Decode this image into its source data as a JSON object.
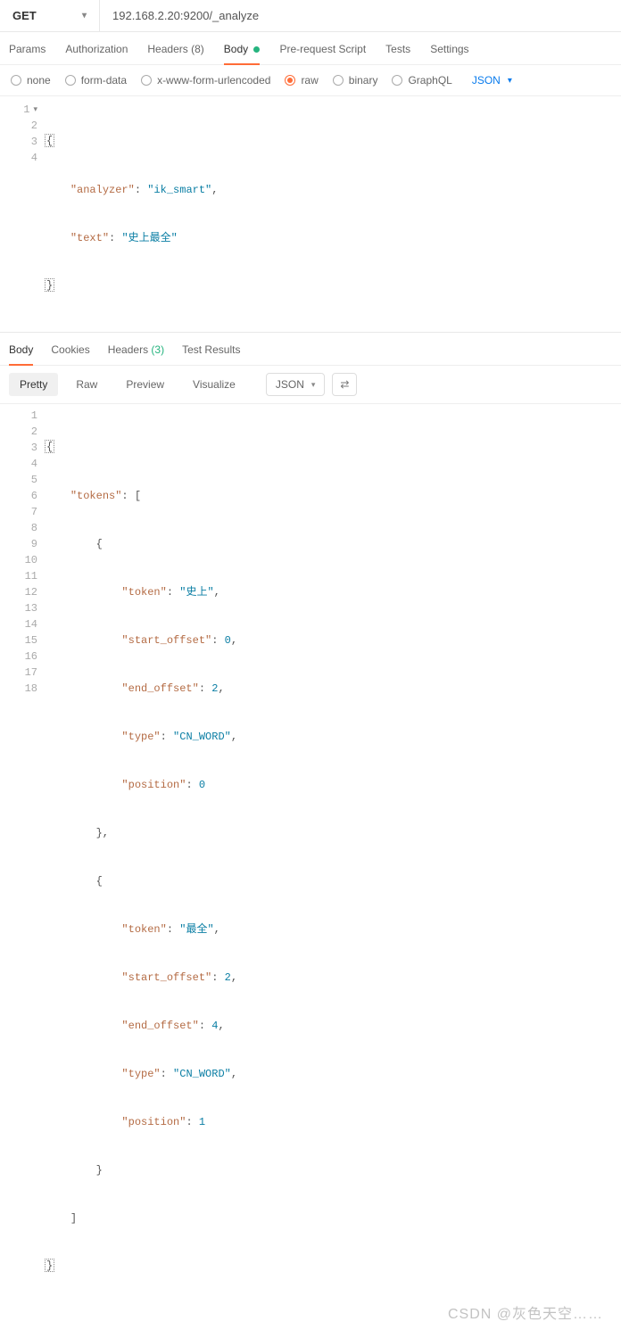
{
  "request": {
    "method": "GET",
    "url": "192.168.2.20:9200/_analyze"
  },
  "tabs": {
    "params": "Params",
    "authorization": "Authorization",
    "headers": "Headers",
    "headers_count": "(8)",
    "body": "Body",
    "prerequest": "Pre-request Script",
    "tests": "Tests",
    "settings": "Settings",
    "active": "body"
  },
  "body_types": {
    "none": "none",
    "form_data": "form-data",
    "x_www": "x-www-form-urlencoded",
    "raw": "raw",
    "binary": "binary",
    "graphql": "GraphQL",
    "selected": "raw",
    "lang": "JSON"
  },
  "request_body": {
    "lines": [
      "1",
      "2",
      "3",
      "4"
    ],
    "l1_open": "{",
    "l2_key": "\"analyzer\"",
    "l2_val": "\"ik_smart\"",
    "l3_key": "\"text\"",
    "l3_val": "\"史上最全\"",
    "l4_close": "}"
  },
  "response_tabs": {
    "body": "Body",
    "cookies": "Cookies",
    "headers": "Headers",
    "headers_count": "(3)",
    "test_results": "Test Results",
    "active": "body"
  },
  "view_modes": {
    "pretty": "Pretty",
    "raw": "Raw",
    "preview": "Preview",
    "visualize": "Visualize",
    "active": "pretty",
    "lang": "JSON"
  },
  "response_body": {
    "line_count": 18,
    "l1": "{",
    "l2_key": "\"tokens\"",
    "l2_after": ": [",
    "l3": "{",
    "l4_key": "\"token\"",
    "l4_val": "\"史上\"",
    "l5_key": "\"start_offset\"",
    "l5_val": "0",
    "l6_key": "\"end_offset\"",
    "l6_val": "2",
    "l7_key": "\"type\"",
    "l7_val": "\"CN_WORD\"",
    "l8_key": "\"position\"",
    "l8_val": "0",
    "l9": "},",
    "l10": "{",
    "l11_key": "\"token\"",
    "l11_val": "\"最全\"",
    "l12_key": "\"start_offset\"",
    "l12_val": "2",
    "l13_key": "\"end_offset\"",
    "l13_val": "4",
    "l14_key": "\"type\"",
    "l14_val": "\"CN_WORD\"",
    "l15_key": "\"position\"",
    "l15_val": "1",
    "l16": "}",
    "l17": "]",
    "l18": "}"
  },
  "watermark": "CSDN @灰色天空……"
}
